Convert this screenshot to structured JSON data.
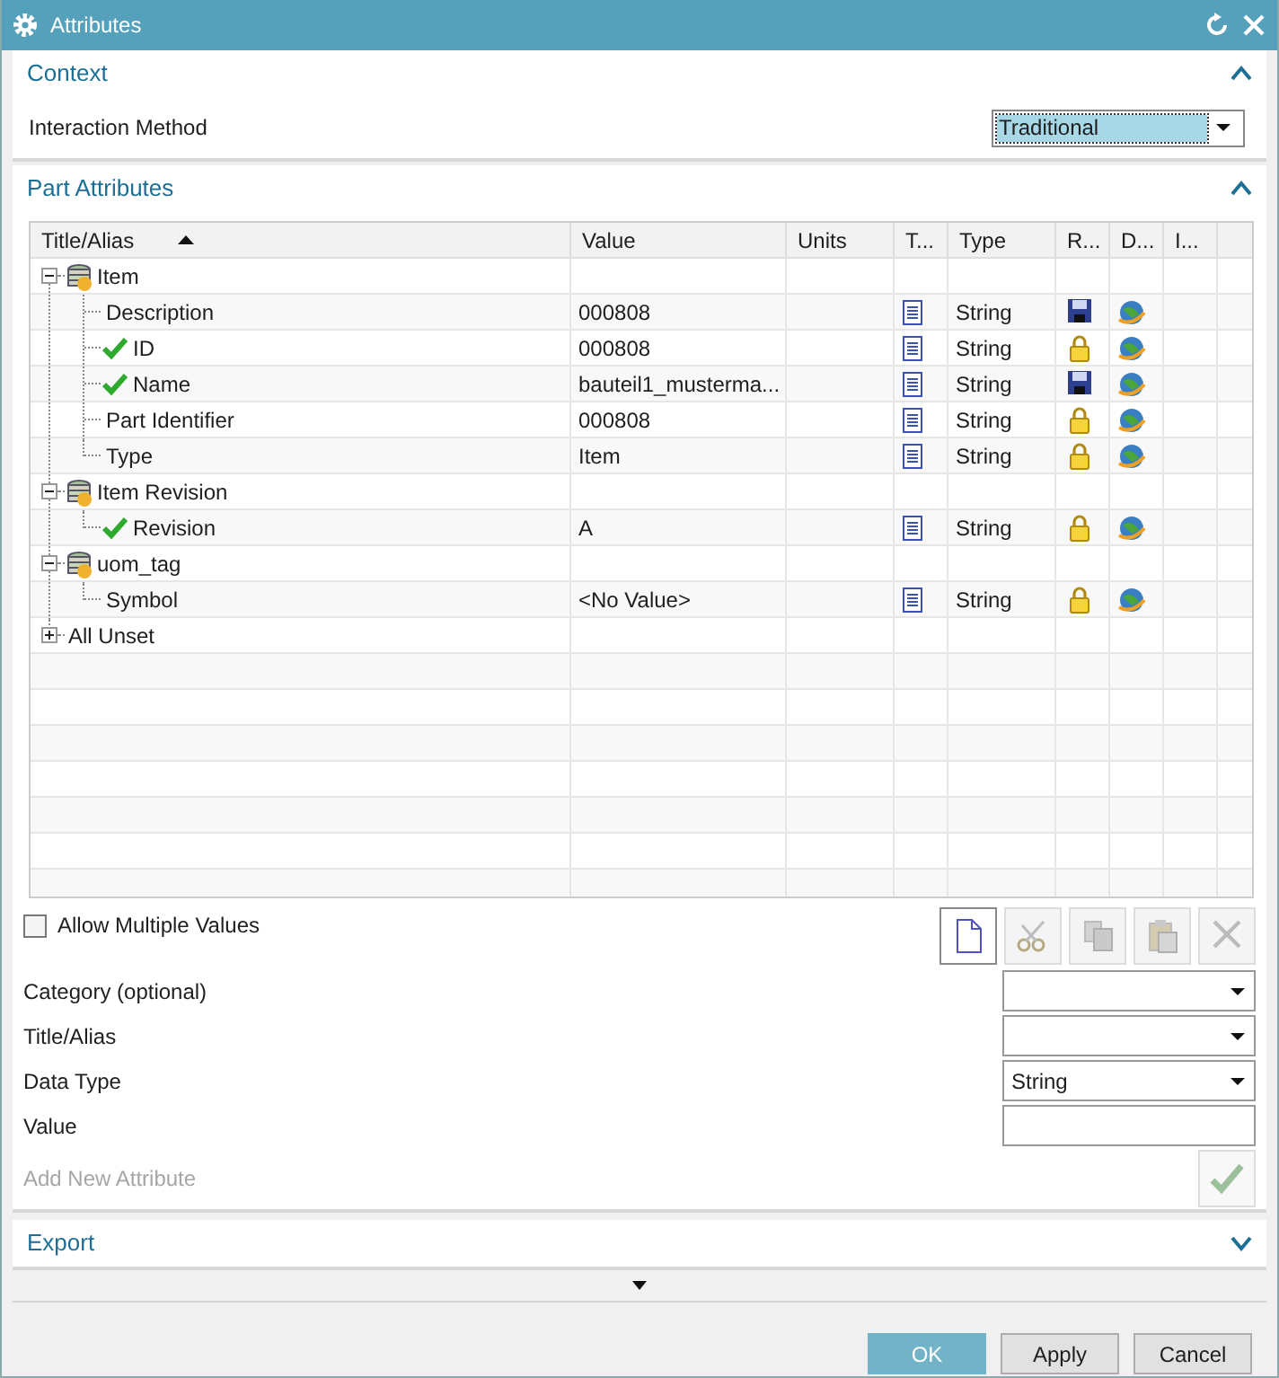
{
  "window": {
    "title": "Attributes"
  },
  "context": {
    "title": "Context",
    "expanded": true,
    "field_label": "Interaction Method",
    "field_value": "Traditional"
  },
  "part_attributes": {
    "title": "Part Attributes",
    "expanded": true,
    "columns": [
      "Title/Alias",
      "Value",
      "Units",
      "T...",
      "Type",
      "R...",
      "D...",
      "I..."
    ],
    "sort_ascending": true,
    "tree": [
      {
        "title": "Item",
        "expanded": true,
        "children": [
          {
            "title": "Description",
            "checked": false,
            "value": "000808",
            "type": "String",
            "kind": "save"
          },
          {
            "title": "ID",
            "checked": true,
            "value": "000808",
            "type": "String",
            "kind": "lock"
          },
          {
            "title": "Name",
            "checked": true,
            "value": "bauteil1_musterma...",
            "type": "String",
            "kind": "save"
          },
          {
            "title": "Part Identifier",
            "checked": false,
            "value": "000808",
            "type": "String",
            "kind": "lock"
          },
          {
            "title": "Type",
            "checked": false,
            "value": "Item",
            "type": "String",
            "kind": "lock"
          }
        ]
      },
      {
        "title": "Item Revision",
        "expanded": true,
        "children": [
          {
            "title": "Revision",
            "checked": true,
            "value": "A",
            "type": "String",
            "kind": "lock"
          }
        ]
      },
      {
        "title": "uom_tag",
        "expanded": true,
        "children": [
          {
            "title": "Symbol",
            "checked": false,
            "value": "<No Value>",
            "type": "String",
            "kind": "lock"
          }
        ]
      },
      {
        "title": "All Unset",
        "expanded": false,
        "kind": "plain"
      }
    ],
    "allow_multiple": {
      "label": "Allow Multiple Values",
      "checked": false
    },
    "toolbar": [
      {
        "kind": "new",
        "disabled": false
      },
      {
        "kind": "cut",
        "disabled": true
      },
      {
        "kind": "copy",
        "disabled": true
      },
      {
        "kind": "paste",
        "disabled": true
      },
      {
        "kind": "delete",
        "disabled": true
      }
    ],
    "fields": [
      {
        "label": "Category (optional)",
        "kind": "dropdown"
      },
      {
        "label": "Title/Alias",
        "kind": "dropdown"
      },
      {
        "label": "Data Type",
        "kind": "dropdown",
        "value": "String"
      },
      {
        "label": "Value",
        "kind": "text"
      }
    ],
    "add_new": {
      "label": "Add New Attribute",
      "disabled": true
    }
  },
  "export": {
    "title": "Export",
    "expanded": false
  },
  "buttons": [
    {
      "label": "OK",
      "kind": "primary"
    },
    {
      "label": "Apply",
      "kind": "normal"
    },
    {
      "label": "Cancel",
      "kind": "normal"
    }
  ]
}
